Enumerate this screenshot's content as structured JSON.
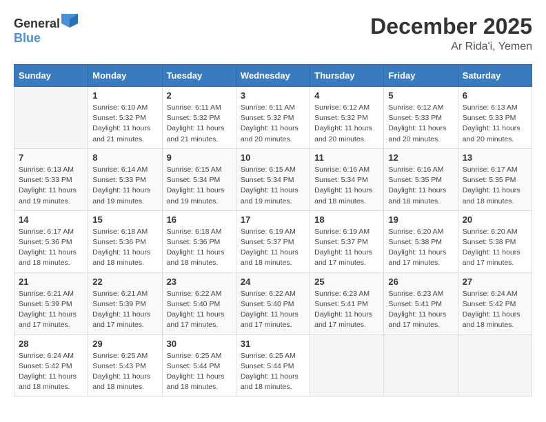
{
  "header": {
    "logo_general": "General",
    "logo_blue": "Blue",
    "month": "December 2025",
    "location": "Ar Rida'i, Yemen"
  },
  "weekdays": [
    "Sunday",
    "Monday",
    "Tuesday",
    "Wednesday",
    "Thursday",
    "Friday",
    "Saturday"
  ],
  "weeks": [
    [
      {
        "day": "",
        "sunrise": "",
        "sunset": "",
        "daylight": ""
      },
      {
        "day": "1",
        "sunrise": "Sunrise: 6:10 AM",
        "sunset": "Sunset: 5:32 PM",
        "daylight": "Daylight: 11 hours and 21 minutes."
      },
      {
        "day": "2",
        "sunrise": "Sunrise: 6:11 AM",
        "sunset": "Sunset: 5:32 PM",
        "daylight": "Daylight: 11 hours and 21 minutes."
      },
      {
        "day": "3",
        "sunrise": "Sunrise: 6:11 AM",
        "sunset": "Sunset: 5:32 PM",
        "daylight": "Daylight: 11 hours and 20 minutes."
      },
      {
        "day": "4",
        "sunrise": "Sunrise: 6:12 AM",
        "sunset": "Sunset: 5:32 PM",
        "daylight": "Daylight: 11 hours and 20 minutes."
      },
      {
        "day": "5",
        "sunrise": "Sunrise: 6:12 AM",
        "sunset": "Sunset: 5:33 PM",
        "daylight": "Daylight: 11 hours and 20 minutes."
      },
      {
        "day": "6",
        "sunrise": "Sunrise: 6:13 AM",
        "sunset": "Sunset: 5:33 PM",
        "daylight": "Daylight: 11 hours and 20 minutes."
      }
    ],
    [
      {
        "day": "7",
        "sunrise": "Sunrise: 6:13 AM",
        "sunset": "Sunset: 5:33 PM",
        "daylight": "Daylight: 11 hours and 19 minutes."
      },
      {
        "day": "8",
        "sunrise": "Sunrise: 6:14 AM",
        "sunset": "Sunset: 5:33 PM",
        "daylight": "Daylight: 11 hours and 19 minutes."
      },
      {
        "day": "9",
        "sunrise": "Sunrise: 6:15 AM",
        "sunset": "Sunset: 5:34 PM",
        "daylight": "Daylight: 11 hours and 19 minutes."
      },
      {
        "day": "10",
        "sunrise": "Sunrise: 6:15 AM",
        "sunset": "Sunset: 5:34 PM",
        "daylight": "Daylight: 11 hours and 19 minutes."
      },
      {
        "day": "11",
        "sunrise": "Sunrise: 6:16 AM",
        "sunset": "Sunset: 5:34 PM",
        "daylight": "Daylight: 11 hours and 18 minutes."
      },
      {
        "day": "12",
        "sunrise": "Sunrise: 6:16 AM",
        "sunset": "Sunset: 5:35 PM",
        "daylight": "Daylight: 11 hours and 18 minutes."
      },
      {
        "day": "13",
        "sunrise": "Sunrise: 6:17 AM",
        "sunset": "Sunset: 5:35 PM",
        "daylight": "Daylight: 11 hours and 18 minutes."
      }
    ],
    [
      {
        "day": "14",
        "sunrise": "Sunrise: 6:17 AM",
        "sunset": "Sunset: 5:36 PM",
        "daylight": "Daylight: 11 hours and 18 minutes."
      },
      {
        "day": "15",
        "sunrise": "Sunrise: 6:18 AM",
        "sunset": "Sunset: 5:36 PM",
        "daylight": "Daylight: 11 hours and 18 minutes."
      },
      {
        "day": "16",
        "sunrise": "Sunrise: 6:18 AM",
        "sunset": "Sunset: 5:36 PM",
        "daylight": "Daylight: 11 hours and 18 minutes."
      },
      {
        "day": "17",
        "sunrise": "Sunrise: 6:19 AM",
        "sunset": "Sunset: 5:37 PM",
        "daylight": "Daylight: 11 hours and 18 minutes."
      },
      {
        "day": "18",
        "sunrise": "Sunrise: 6:19 AM",
        "sunset": "Sunset: 5:37 PM",
        "daylight": "Daylight: 11 hours and 17 minutes."
      },
      {
        "day": "19",
        "sunrise": "Sunrise: 6:20 AM",
        "sunset": "Sunset: 5:38 PM",
        "daylight": "Daylight: 11 hours and 17 minutes."
      },
      {
        "day": "20",
        "sunrise": "Sunrise: 6:20 AM",
        "sunset": "Sunset: 5:38 PM",
        "daylight": "Daylight: 11 hours and 17 minutes."
      }
    ],
    [
      {
        "day": "21",
        "sunrise": "Sunrise: 6:21 AM",
        "sunset": "Sunset: 5:39 PM",
        "daylight": "Daylight: 11 hours and 17 minutes."
      },
      {
        "day": "22",
        "sunrise": "Sunrise: 6:21 AM",
        "sunset": "Sunset: 5:39 PM",
        "daylight": "Daylight: 11 hours and 17 minutes."
      },
      {
        "day": "23",
        "sunrise": "Sunrise: 6:22 AM",
        "sunset": "Sunset: 5:40 PM",
        "daylight": "Daylight: 11 hours and 17 minutes."
      },
      {
        "day": "24",
        "sunrise": "Sunrise: 6:22 AM",
        "sunset": "Sunset: 5:40 PM",
        "daylight": "Daylight: 11 hours and 17 minutes."
      },
      {
        "day": "25",
        "sunrise": "Sunrise: 6:23 AM",
        "sunset": "Sunset: 5:41 PM",
        "daylight": "Daylight: 11 hours and 17 minutes."
      },
      {
        "day": "26",
        "sunrise": "Sunrise: 6:23 AM",
        "sunset": "Sunset: 5:41 PM",
        "daylight": "Daylight: 11 hours and 17 minutes."
      },
      {
        "day": "27",
        "sunrise": "Sunrise: 6:24 AM",
        "sunset": "Sunset: 5:42 PM",
        "daylight": "Daylight: 11 hours and 18 minutes."
      }
    ],
    [
      {
        "day": "28",
        "sunrise": "Sunrise: 6:24 AM",
        "sunset": "Sunset: 5:42 PM",
        "daylight": "Daylight: 11 hours and 18 minutes."
      },
      {
        "day": "29",
        "sunrise": "Sunrise: 6:25 AM",
        "sunset": "Sunset: 5:43 PM",
        "daylight": "Daylight: 11 hours and 18 minutes."
      },
      {
        "day": "30",
        "sunrise": "Sunrise: 6:25 AM",
        "sunset": "Sunset: 5:44 PM",
        "daylight": "Daylight: 11 hours and 18 minutes."
      },
      {
        "day": "31",
        "sunrise": "Sunrise: 6:25 AM",
        "sunset": "Sunset: 5:44 PM",
        "daylight": "Daylight: 11 hours and 18 minutes."
      },
      {
        "day": "",
        "sunrise": "",
        "sunset": "",
        "daylight": ""
      },
      {
        "day": "",
        "sunrise": "",
        "sunset": "",
        "daylight": ""
      },
      {
        "day": "",
        "sunrise": "",
        "sunset": "",
        "daylight": ""
      }
    ]
  ]
}
